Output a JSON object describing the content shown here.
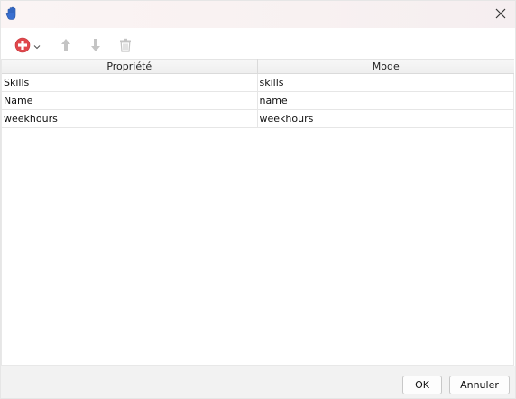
{
  "titlebar": {
    "app_icon": "hand-icon",
    "close_icon": "close-icon"
  },
  "toolbar": {
    "add_icon": "add-circle-icon",
    "add_dropdown_icon": "chevron-down-icon",
    "move_up_icon": "arrow-up-icon",
    "move_down_icon": "arrow-down-icon",
    "delete_icon": "trash-icon",
    "accent_add": "#e0474c",
    "disabled_color": "#c4c4c4"
  },
  "table": {
    "columns": [
      "Propriété",
      "Mode"
    ],
    "rows": [
      [
        "Skills",
        "skills"
      ],
      [
        "Name",
        "name"
      ],
      [
        "weekhours",
        "weekhours"
      ]
    ]
  },
  "footer": {
    "ok_label": "OK",
    "cancel_label": "Annuler"
  }
}
